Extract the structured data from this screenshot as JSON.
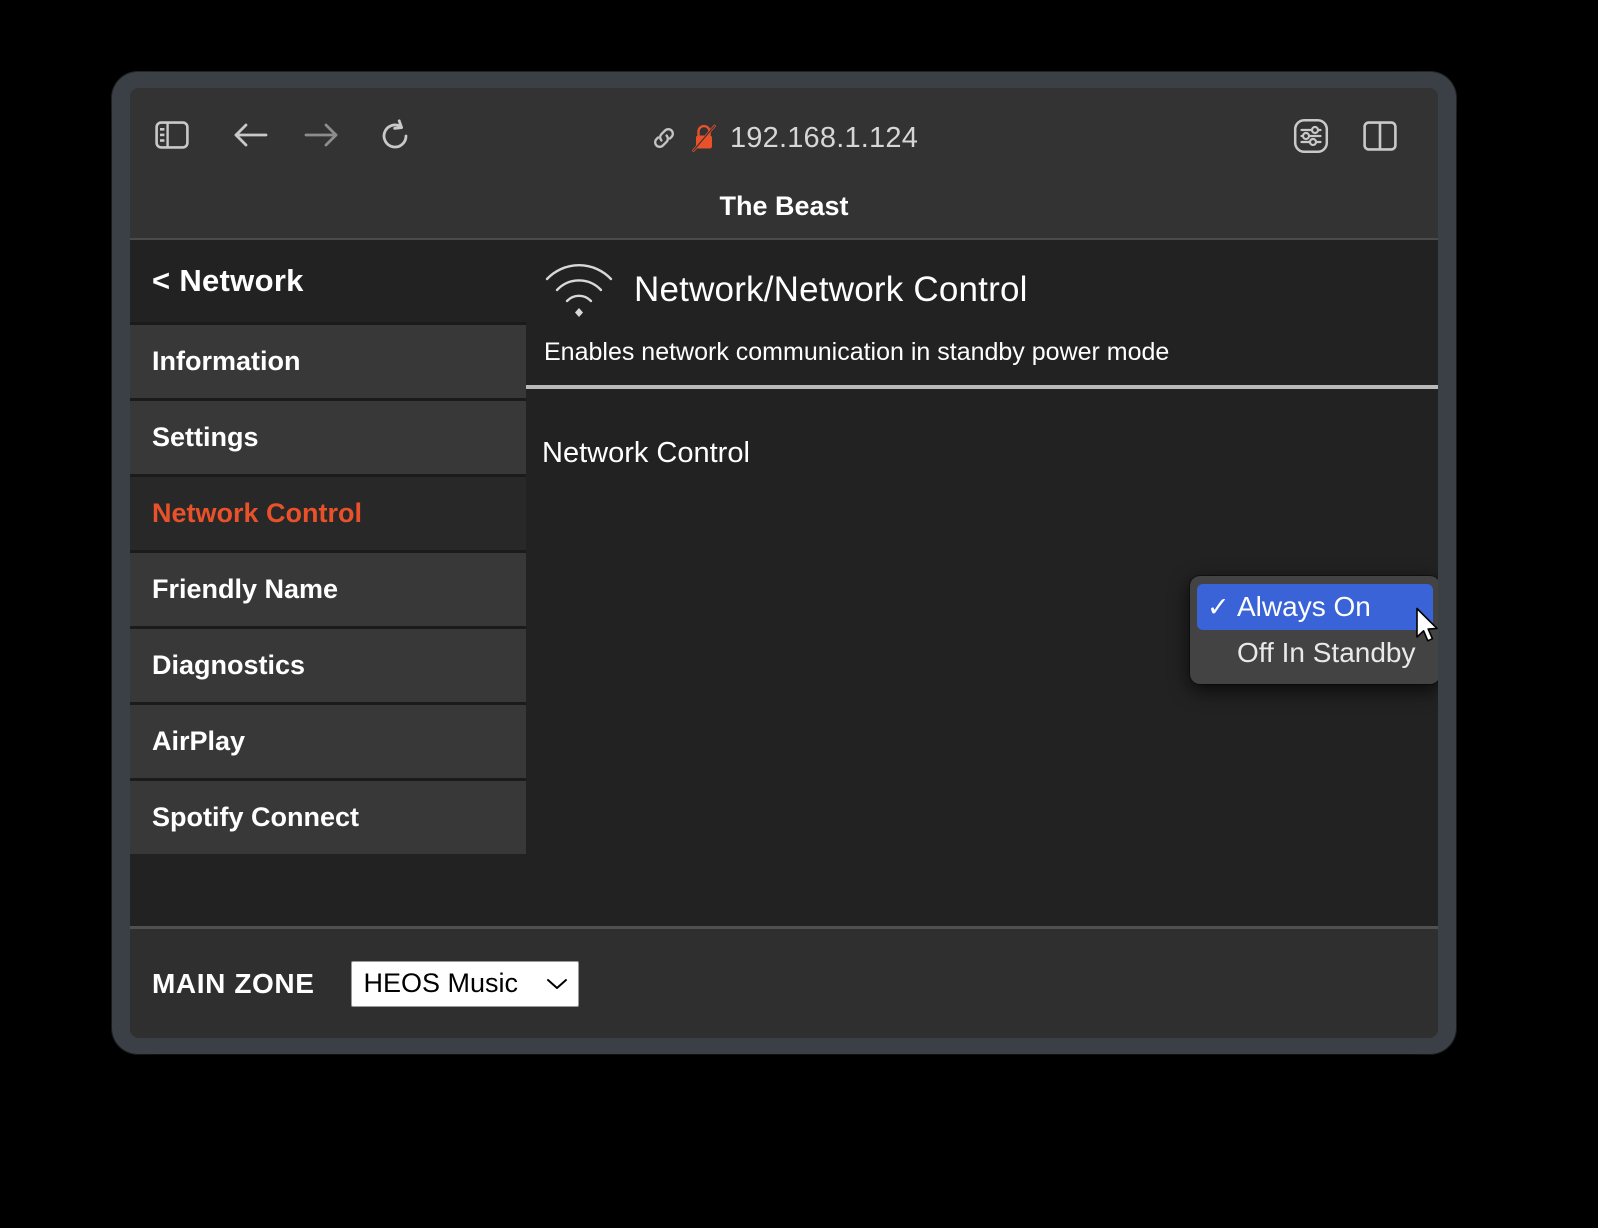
{
  "browser": {
    "url": "192.168.1.124",
    "icons": {
      "sidebar_toggle": "sidebar-toggle-icon",
      "back": "back-arrow-icon",
      "forward": "forward-arrow-icon",
      "reload": "reload-icon",
      "link": "link-icon",
      "insecure_lock": "insecure-lock-icon",
      "page_settings": "page-settings-icon",
      "tab_overview": "tab-overview-icon"
    }
  },
  "page": {
    "title": "The Beast"
  },
  "sidebar": {
    "back_label": "< Network",
    "items": [
      {
        "label": "Information",
        "active": false
      },
      {
        "label": "Settings",
        "active": false
      },
      {
        "label": "Network Control",
        "active": true
      },
      {
        "label": "Friendly Name",
        "active": false
      },
      {
        "label": "Diagnostics",
        "active": false
      },
      {
        "label": "AirPlay",
        "active": false
      },
      {
        "label": "Spotify Connect",
        "active": false
      }
    ]
  },
  "content": {
    "icon": "wifi-icon",
    "title": "Network/Network Control",
    "subtitle": "Enables network communication in standby power mode",
    "setting": {
      "label": "Network Control",
      "selected_value": "Always On",
      "options": [
        {
          "label": "Always On",
          "selected": true
        },
        {
          "label": "Off In Standby",
          "selected": false
        }
      ]
    }
  },
  "zone_bar": {
    "label": "MAIN ZONE",
    "select_value": "HEOS Music"
  },
  "colors": {
    "accent_orange": "#e8512a",
    "highlight_blue": "#3b63d8",
    "insecure_red": "#e8512a"
  }
}
